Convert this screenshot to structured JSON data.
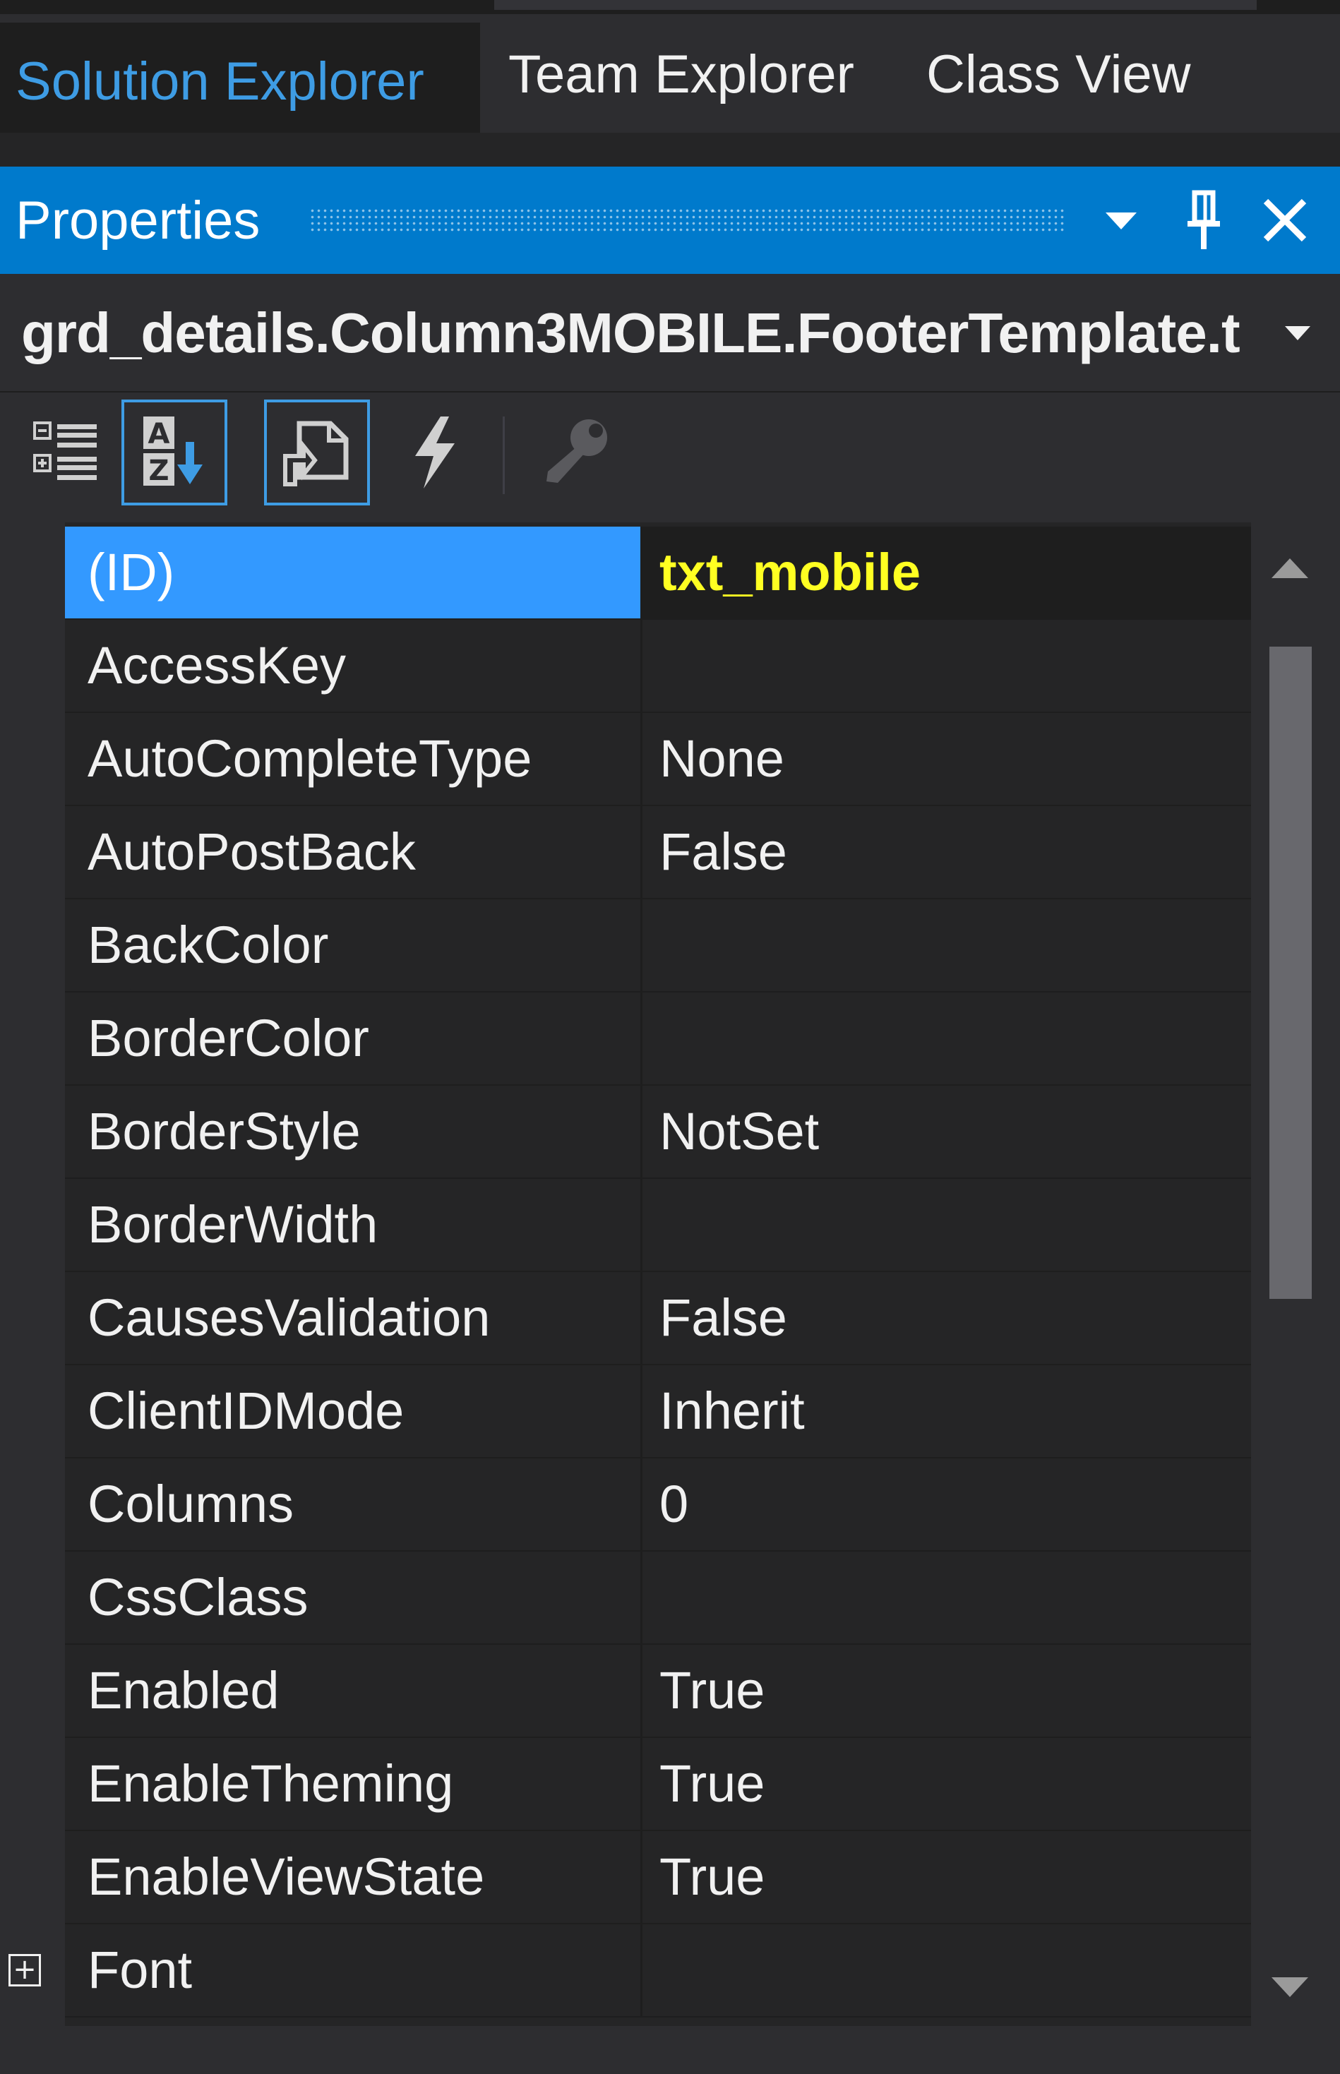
{
  "tabs": [
    {
      "label": "Solution Explorer",
      "active": true
    },
    {
      "label": "Team Explorer",
      "active": false
    },
    {
      "label": "Class View",
      "active": false
    }
  ],
  "panel": {
    "title": "Properties",
    "icons": [
      "dropdown-arrow-icon",
      "pin-icon",
      "close-icon"
    ]
  },
  "selector": {
    "object_name": "grd_details.Column3MOBILE.FooterTemplate.t"
  },
  "toolbar": {
    "buttons": [
      {
        "name": "categorized-icon",
        "checked": false
      },
      {
        "name": "alphabetical-icon",
        "checked": true
      },
      {
        "name": "properties-icon",
        "checked": true
      },
      {
        "name": "events-icon",
        "checked": false
      },
      {
        "name": "property-pages-icon",
        "checked": false,
        "disabled": true
      }
    ]
  },
  "grid": {
    "rows": [
      {
        "name": "(ID)",
        "value": "txt_mobile",
        "selected": true
      },
      {
        "name": "AccessKey",
        "value": ""
      },
      {
        "name": "AutoCompleteType",
        "value": "None"
      },
      {
        "name": "AutoPostBack",
        "value": "False"
      },
      {
        "name": "BackColor",
        "value": ""
      },
      {
        "name": "BorderColor",
        "value": ""
      },
      {
        "name": "BorderStyle",
        "value": "NotSet"
      },
      {
        "name": "BorderWidth",
        "value": ""
      },
      {
        "name": "CausesValidation",
        "value": "False"
      },
      {
        "name": "ClientIDMode",
        "value": "Inherit"
      },
      {
        "name": "Columns",
        "value": "0"
      },
      {
        "name": "CssClass",
        "value": ""
      },
      {
        "name": "Enabled",
        "value": "True"
      },
      {
        "name": "EnableTheming",
        "value": "True"
      },
      {
        "name": "EnableViewState",
        "value": "True"
      },
      {
        "name": "Font",
        "value": "",
        "expandable": true,
        "expander_glyph": "+"
      }
    ]
  },
  "colors": {
    "accent": "#007acc",
    "selection": "#3399ff",
    "active_tab_text": "#3e9ce4",
    "selected_value_text": "#ffff22",
    "background": "#2d2d30"
  }
}
